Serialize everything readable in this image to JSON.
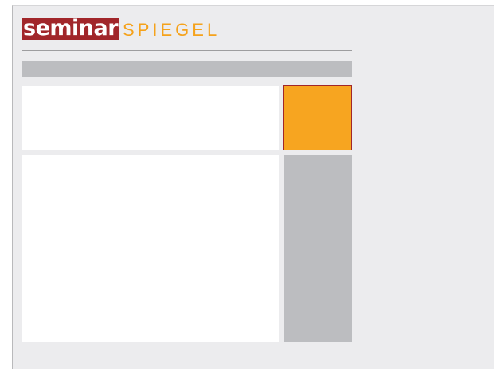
{
  "brand": {
    "part1": "seminar",
    "part2": "SPIEGEL",
    "part1_bg": "#a1262a",
    "part2_color": "#f5a21b"
  },
  "colors": {
    "page_bg": "#ececee",
    "navbar": "#bcbdc0",
    "accent_box": "#f7a520",
    "accent_border": "#a1262a",
    "sidebar": "#bcbdc0",
    "content": "#ffffff"
  }
}
